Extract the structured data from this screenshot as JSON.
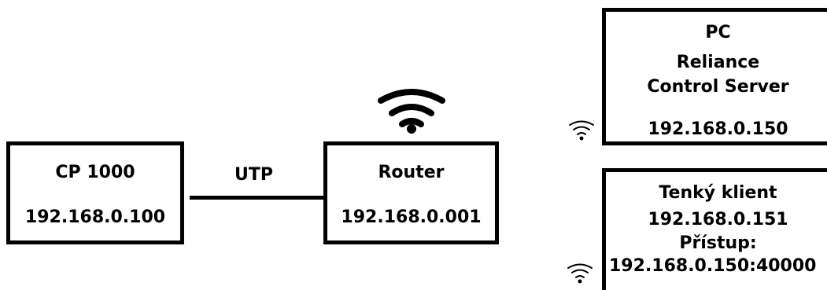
{
  "nodes": {
    "cp1000": {
      "name": "CP 1000",
      "ip": "192.168.0.100"
    },
    "router": {
      "name": "Router",
      "ip": "192.168.0.001"
    },
    "pc": {
      "line1": "PC",
      "line2": "Reliance",
      "line3": "Control Server",
      "ip": "192.168.0.150"
    },
    "thin_client": {
      "name": "Tenký klient",
      "ip": "192.168.0.151",
      "access_label": "Přístup:",
      "access_addr": "192.168.0.150:40000"
    }
  },
  "links": {
    "cp1000_router": {
      "label": "UTP"
    }
  },
  "icons": {
    "router_wifi": "wifi-icon",
    "pc_wifi": "wifi-icon",
    "thin_client_wifi": "wifi-icon"
  }
}
